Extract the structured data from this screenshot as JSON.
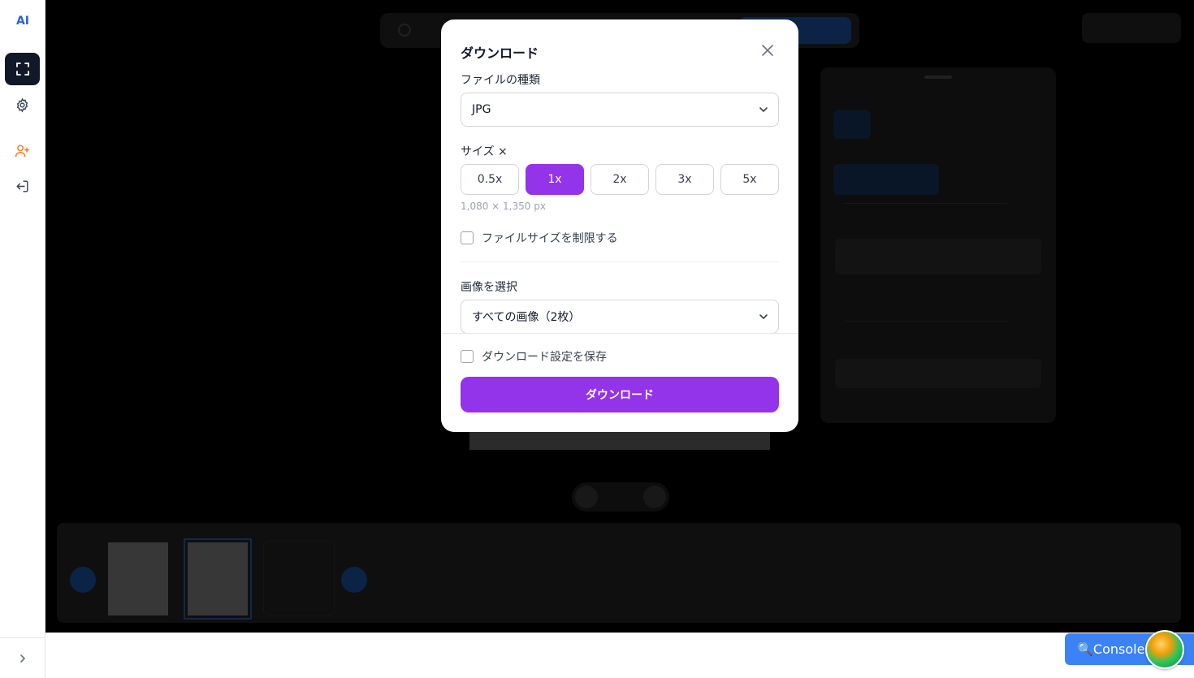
{
  "sidebar": {
    "logo": "AI"
  },
  "modal": {
    "title": "ダウンロード",
    "file_type_label": "ファイルの種類",
    "file_type_value": "JPG",
    "size_label": "サイズ ×",
    "size_options": [
      "0.5x",
      "1x",
      "2x",
      "3x",
      "5x"
    ],
    "size_selected": "1x",
    "dimensions": "1,080 × 1,350 px",
    "limit_file_size_label": "ファイルサイズを制限する",
    "select_images_label": "画像を選択",
    "select_images_value": "すべての画像（2枚）",
    "save_settings_label": "ダウンロード設定を保存",
    "download_button": "ダウンロード"
  },
  "console": {
    "label": "🔍Console"
  },
  "colors": {
    "accent": "#9333ea",
    "logo": "#2563eb",
    "console": "#3b82f6"
  }
}
